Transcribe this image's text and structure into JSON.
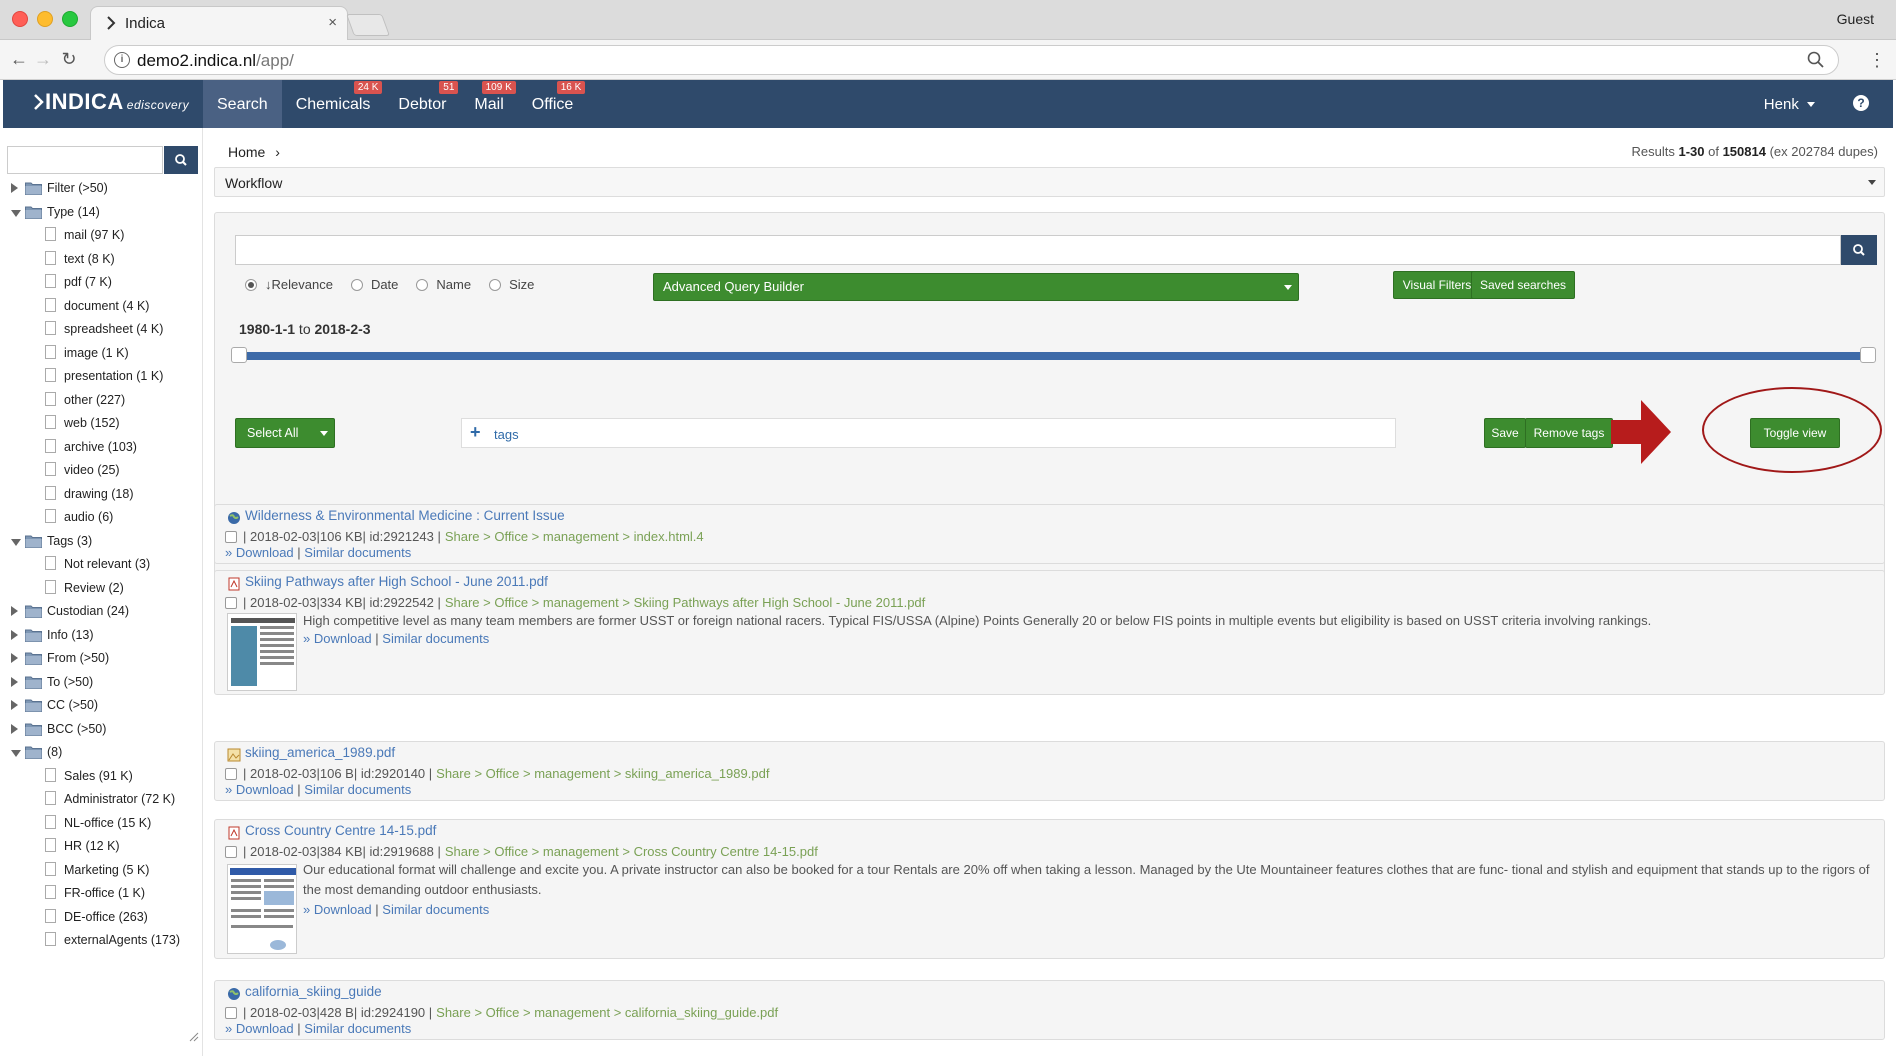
{
  "browser": {
    "tab_title": "Indica",
    "tab_close": "×",
    "profile": "Guest",
    "url_host": "demo2.indica.nl",
    "url_path": "/app/",
    "back": "←",
    "forward": "→",
    "reload": "↻",
    "menu": "⋮"
  },
  "app": {
    "brand": "INDICA",
    "brand_sub": "ediscovery",
    "nav": [
      {
        "label": "Search",
        "badge": ""
      },
      {
        "label": "Chemicals",
        "badge": "24 K"
      },
      {
        "label": "Debtor",
        "badge": "51"
      },
      {
        "label": "Mail",
        "badge": "109 K"
      },
      {
        "label": "Office",
        "badge": "16 K"
      }
    ],
    "user": "Henk",
    "help": "?"
  },
  "sidebar": {
    "tree": [
      {
        "label": "Filter (>50)",
        "level": 0,
        "state": "collapsed"
      },
      {
        "label": "Type (14)",
        "level": 0,
        "state": "expanded"
      },
      {
        "label": "mail (97 K)",
        "level": 1
      },
      {
        "label": "text (8 K)",
        "level": 1
      },
      {
        "label": "pdf (7 K)",
        "level": 1
      },
      {
        "label": "document (4 K)",
        "level": 1
      },
      {
        "label": "spreadsheet (4 K)",
        "level": 1
      },
      {
        "label": "image (1 K)",
        "level": 1
      },
      {
        "label": "presentation (1 K)",
        "level": 1
      },
      {
        "label": "other (227)",
        "level": 1
      },
      {
        "label": "web (152)",
        "level": 1
      },
      {
        "label": "archive (103)",
        "level": 1
      },
      {
        "label": "video (25)",
        "level": 1
      },
      {
        "label": "drawing (18)",
        "level": 1
      },
      {
        "label": "audio (6)",
        "level": 1
      },
      {
        "label": "Tags (3)",
        "level": 0,
        "state": "expanded"
      },
      {
        "label": "Not relevant (3)",
        "level": 1
      },
      {
        "label": "Review (2)",
        "level": 1
      },
      {
        "label": "Custodian (24)",
        "level": 0,
        "state": "collapsed"
      },
      {
        "label": "Info (13)",
        "level": 0,
        "state": "collapsed"
      },
      {
        "label": "From (>50)",
        "level": 0,
        "state": "collapsed"
      },
      {
        "label": "To (>50)",
        "level": 0,
        "state": "collapsed"
      },
      {
        "label": "CC (>50)",
        "level": 0,
        "state": "collapsed"
      },
      {
        "label": "BCC (>50)",
        "level": 0,
        "state": "collapsed"
      },
      {
        "label": "(8)",
        "level": 0,
        "state": "expanded"
      },
      {
        "label": "Sales (91 K)",
        "level": 1
      },
      {
        "label": "Administrator (72 K)",
        "level": 1
      },
      {
        "label": "NL-office (15 K)",
        "level": 1
      },
      {
        "label": "HR (12 K)",
        "level": 1
      },
      {
        "label": "Marketing (5 K)",
        "level": 1
      },
      {
        "label": "FR-office (1 K)",
        "level": 1
      },
      {
        "label": "DE-office (263)",
        "level": 1
      },
      {
        "label": "externalAgents (173)",
        "level": 1
      }
    ]
  },
  "main": {
    "breadcrumb": "Home",
    "breadcrumb_sep": "›",
    "results_prefix": "Results ",
    "results_range": "1-30",
    "results_of": " of ",
    "results_total": "150814",
    "results_suffix": " (ex 202784 dupes)",
    "workflow_label": "Workflow",
    "sort_options": [
      "↓Relevance",
      "Date",
      "Name",
      "Size"
    ],
    "advanced_query": "Advanced Query Builder",
    "visual_filters": "Visual Filters",
    "saved_searches": "Saved searches",
    "date_from": "1980-1-1",
    "date_to_word": " to ",
    "date_to": "2018-2-3",
    "select_all": "Select All",
    "tags_placeholder": "tags",
    "save": "Save",
    "remove_tags": "Remove tags",
    "toggle_view": "Toggle view"
  },
  "results": [
    {
      "title": "Wilderness & Environmental Medicine : Current Issue",
      "icon": "globe-icon",
      "meta": "| 2018-02-03|106 KB| id:2921243 |",
      "path": "Share > Office > management > index.html.4",
      "snippet": "",
      "download": "» Download",
      "similar": "Similar documents"
    },
    {
      "title": "Skiing Pathways after High School - June 2011.pdf",
      "icon": "pdf-icon",
      "meta": "| 2018-02-03|334 KB| id:2922542 |",
      "path": "Share > Office > management > Skiing Pathways after High School - June 2011.pdf",
      "snippet": "High competitive level as many team members are former USST or foreign national racers. Typical FIS/USSA (Alpine) Points Generally 20 or below FIS points in multiple events but eligibility is based on USST criteria involving rankings.",
      "download": "» Download",
      "similar": "Similar documents"
    },
    {
      "title": "skiing_america_1989.pdf",
      "icon": "image-file-icon",
      "meta": "| 2018-02-03|106 B| id:2920140 |",
      "path": "Share > Office > management > skiing_america_1989.pdf",
      "snippet": "",
      "download": "» Download",
      "similar": "Similar documents"
    },
    {
      "title": "Cross Country Centre 14-15.pdf",
      "icon": "pdf-icon",
      "meta": "| 2018-02-03|384 KB| id:2919688 |",
      "path": "Share > Office > management > Cross Country Centre 14-15.pdf",
      "snippet": "Our educational format will challenge and excite you. A private instructor can also be booked for a tour Rentals are 20% off when taking a lesson. Managed by the Ute Mountaineer features clothes that are func- tional and stylish and equipment that stands up to the rigors of the most demanding outdoor enthusiasts.",
      "download": "» Download",
      "similar": "Similar documents"
    },
    {
      "title": "california_skiing_guide",
      "icon": "globe-icon",
      "meta": "| 2018-02-03|428 B| id:2924190 |",
      "path": "Share > Office > management > california_skiing_guide.pdf",
      "snippet": "",
      "download": "» Download",
      "similar": "Similar documents"
    }
  ],
  "colors": {
    "header": "#2f4a6b",
    "green": "#3d8c2f",
    "link": "#4a79b8",
    "path": "#7aa155",
    "annotation": "#b71c1c"
  }
}
